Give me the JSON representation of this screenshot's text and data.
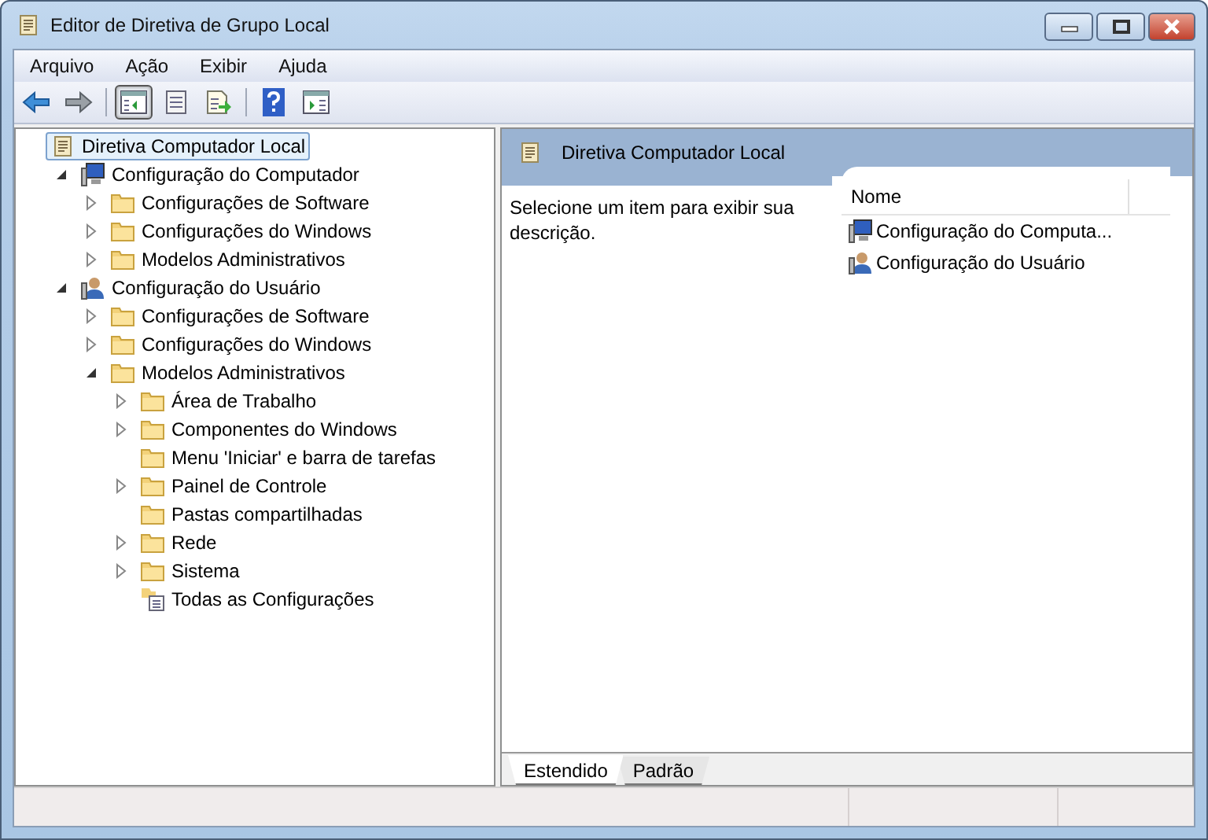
{
  "window": {
    "title": "Editor de Diretiva de Grupo Local"
  },
  "menu": [
    "Arquivo",
    "Ação",
    "Exibir",
    "Ajuda"
  ],
  "toolbar": [
    {
      "kind": "back",
      "pressed": false
    },
    {
      "kind": "forward",
      "pressed": false
    },
    {
      "kind": "tree",
      "pressed": true
    },
    {
      "kind": "properties",
      "pressed": false
    },
    {
      "kind": "export",
      "pressed": false
    },
    {
      "kind": "help",
      "pressed": false
    },
    {
      "kind": "pane",
      "pressed": false
    }
  ],
  "tree": [
    {
      "label": "Diretiva Computador Local",
      "kind": "scroll",
      "selected": true,
      "children": [
        {
          "label": "Configuração do Computador",
          "kind": "computer",
          "selected": false,
          "expanded": true,
          "children": [
            {
              "label": "Configurações de Software",
              "kind": "folder",
              "selected": false,
              "expanded": false
            },
            {
              "label": "Configurações do Windows",
              "kind": "folder",
              "selected": false,
              "expanded": false
            },
            {
              "label": "Modelos Administrativos",
              "kind": "folder",
              "selected": false,
              "expanded": false
            }
          ]
        },
        {
          "label": "Configuração do Usuário",
          "kind": "user",
          "selected": false,
          "expanded": true,
          "children": [
            {
              "label": "Configurações de Software",
              "kind": "folder",
              "selected": false,
              "expanded": false
            },
            {
              "label": "Configurações do Windows",
              "kind": "folder",
              "selected": false,
              "expanded": false
            },
            {
              "label": "Modelos Administrativos",
              "kind": "folder",
              "selected": false,
              "expanded": true,
              "children": [
                {
                  "label": "Área de Trabalho",
                  "kind": "folder",
                  "selected": false,
                  "expanded": false
                },
                {
                  "label": "Componentes do Windows",
                  "kind": "folder",
                  "selected": false,
                  "expanded": false
                },
                {
                  "label": "Menu 'Iniciar' e barra de tarefas",
                  "kind": "folder",
                  "selected": false
                },
                {
                  "label": "Painel de Controle",
                  "kind": "folder",
                  "selected": false,
                  "expanded": false
                },
                {
                  "label": "Pastas compartilhadas",
                  "kind": "folder",
                  "selected": false
                },
                {
                  "label": "Rede",
                  "kind": "folder",
                  "selected": false,
                  "expanded": false
                },
                {
                  "label": "Sistema",
                  "kind": "folder",
                  "selected": false,
                  "expanded": false
                },
                {
                  "label": "Todas as Configurações",
                  "kind": "settings",
                  "selected": false
                }
              ]
            }
          ]
        }
      ]
    }
  ],
  "details": {
    "title": "Diretiva Computador Local",
    "description": "Selecione um item para exibir sua descrição.",
    "columns": [
      "Nome"
    ],
    "rows": [
      {
        "label": "Configuração do Computa...",
        "kind": "computer",
        "selected": false
      },
      {
        "label": "Configuração do Usuário",
        "kind": "user",
        "selected": false
      }
    ]
  },
  "tabs": [
    {
      "label": "Estendido",
      "selected": true
    },
    {
      "label": "Padrão",
      "selected": false
    }
  ]
}
